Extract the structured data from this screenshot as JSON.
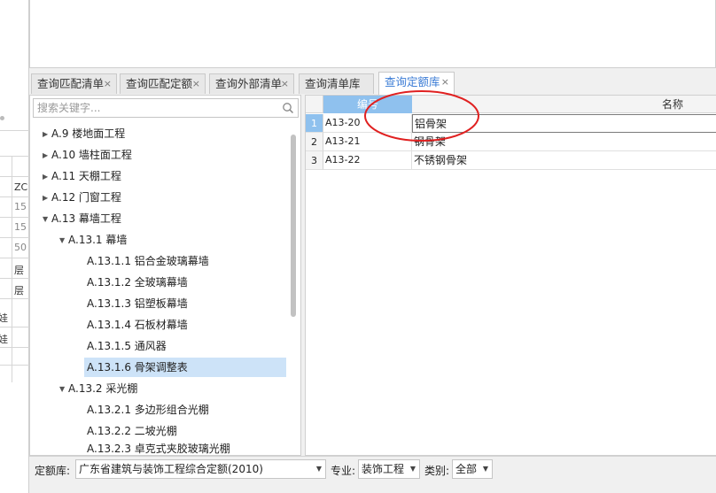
{
  "left_strip": {
    "cells": [
      "ZC",
      "15",
      "15",
      "50",
      "层",
      "层"
    ],
    "edge_chars": [
      "娃",
      "娃"
    ]
  },
  "tabs": [
    {
      "label": "查询匹配清单"
    },
    {
      "label": "查询匹配定额"
    },
    {
      "label": "查询外部清单"
    },
    {
      "label": "查询清单库"
    },
    {
      "label": "查询定额库",
      "active": true
    }
  ],
  "tab_close": "×",
  "search": {
    "placeholder": "搜索关键字..."
  },
  "tree": [
    {
      "label": "A.9 楼地面工程",
      "level": 0,
      "expanded": false
    },
    {
      "label": "A.10 墙柱面工程",
      "level": 0,
      "expanded": false
    },
    {
      "label": "A.11 天棚工程",
      "level": 0,
      "expanded": false
    },
    {
      "label": "A.12 门窗工程",
      "level": 0,
      "expanded": false
    },
    {
      "label": "A.13 幕墙工程",
      "level": 0,
      "expanded": true
    },
    {
      "label": "A.13.1 幕墙",
      "level": 1,
      "expanded": true
    },
    {
      "label": "A.13.1.1 铝合金玻璃幕墙",
      "level": 2
    },
    {
      "label": "A.13.1.2 全玻璃幕墙",
      "level": 2
    },
    {
      "label": "A.13.1.3 铝塑板幕墙",
      "level": 2
    },
    {
      "label": "A.13.1.4 石板材幕墙",
      "level": 2
    },
    {
      "label": "A.13.1.5 通风器",
      "level": 2
    },
    {
      "label": "A.13.1.6 骨架调整表",
      "level": 2,
      "selected": true
    },
    {
      "label": "A.13.2 采光棚",
      "level": 1,
      "expanded": true
    },
    {
      "label": "A.13.2.1 多边形组合光棚",
      "level": 2
    },
    {
      "label": "A.13.2.2 二坡光棚",
      "level": 2
    },
    {
      "label": "A.13.2.3 卓克式夹胶玻璃光棚",
      "level": 2
    }
  ],
  "grid": {
    "columns": {
      "code": "编号",
      "name": "名称"
    },
    "rows": [
      {
        "num": "1",
        "code": "A13-20",
        "name": "铝骨架"
      },
      {
        "num": "2",
        "code": "A13-21",
        "name": "钢骨架"
      },
      {
        "num": "3",
        "code": "A13-22",
        "name": "不锈钢骨架"
      }
    ]
  },
  "bottom": {
    "quota_label": "定额库:",
    "quota_value": "广东省建筑与装饰工程综合定额(2010)",
    "major_label": "专业:",
    "major_value": "装饰工程",
    "type_label": "类别:",
    "type_value": "全部"
  },
  "colors": {
    "accent": "#3a7bd5",
    "selected_row": "#cde3f8",
    "header_highlight": "#8fc1ee",
    "annotation": "#e02020"
  }
}
